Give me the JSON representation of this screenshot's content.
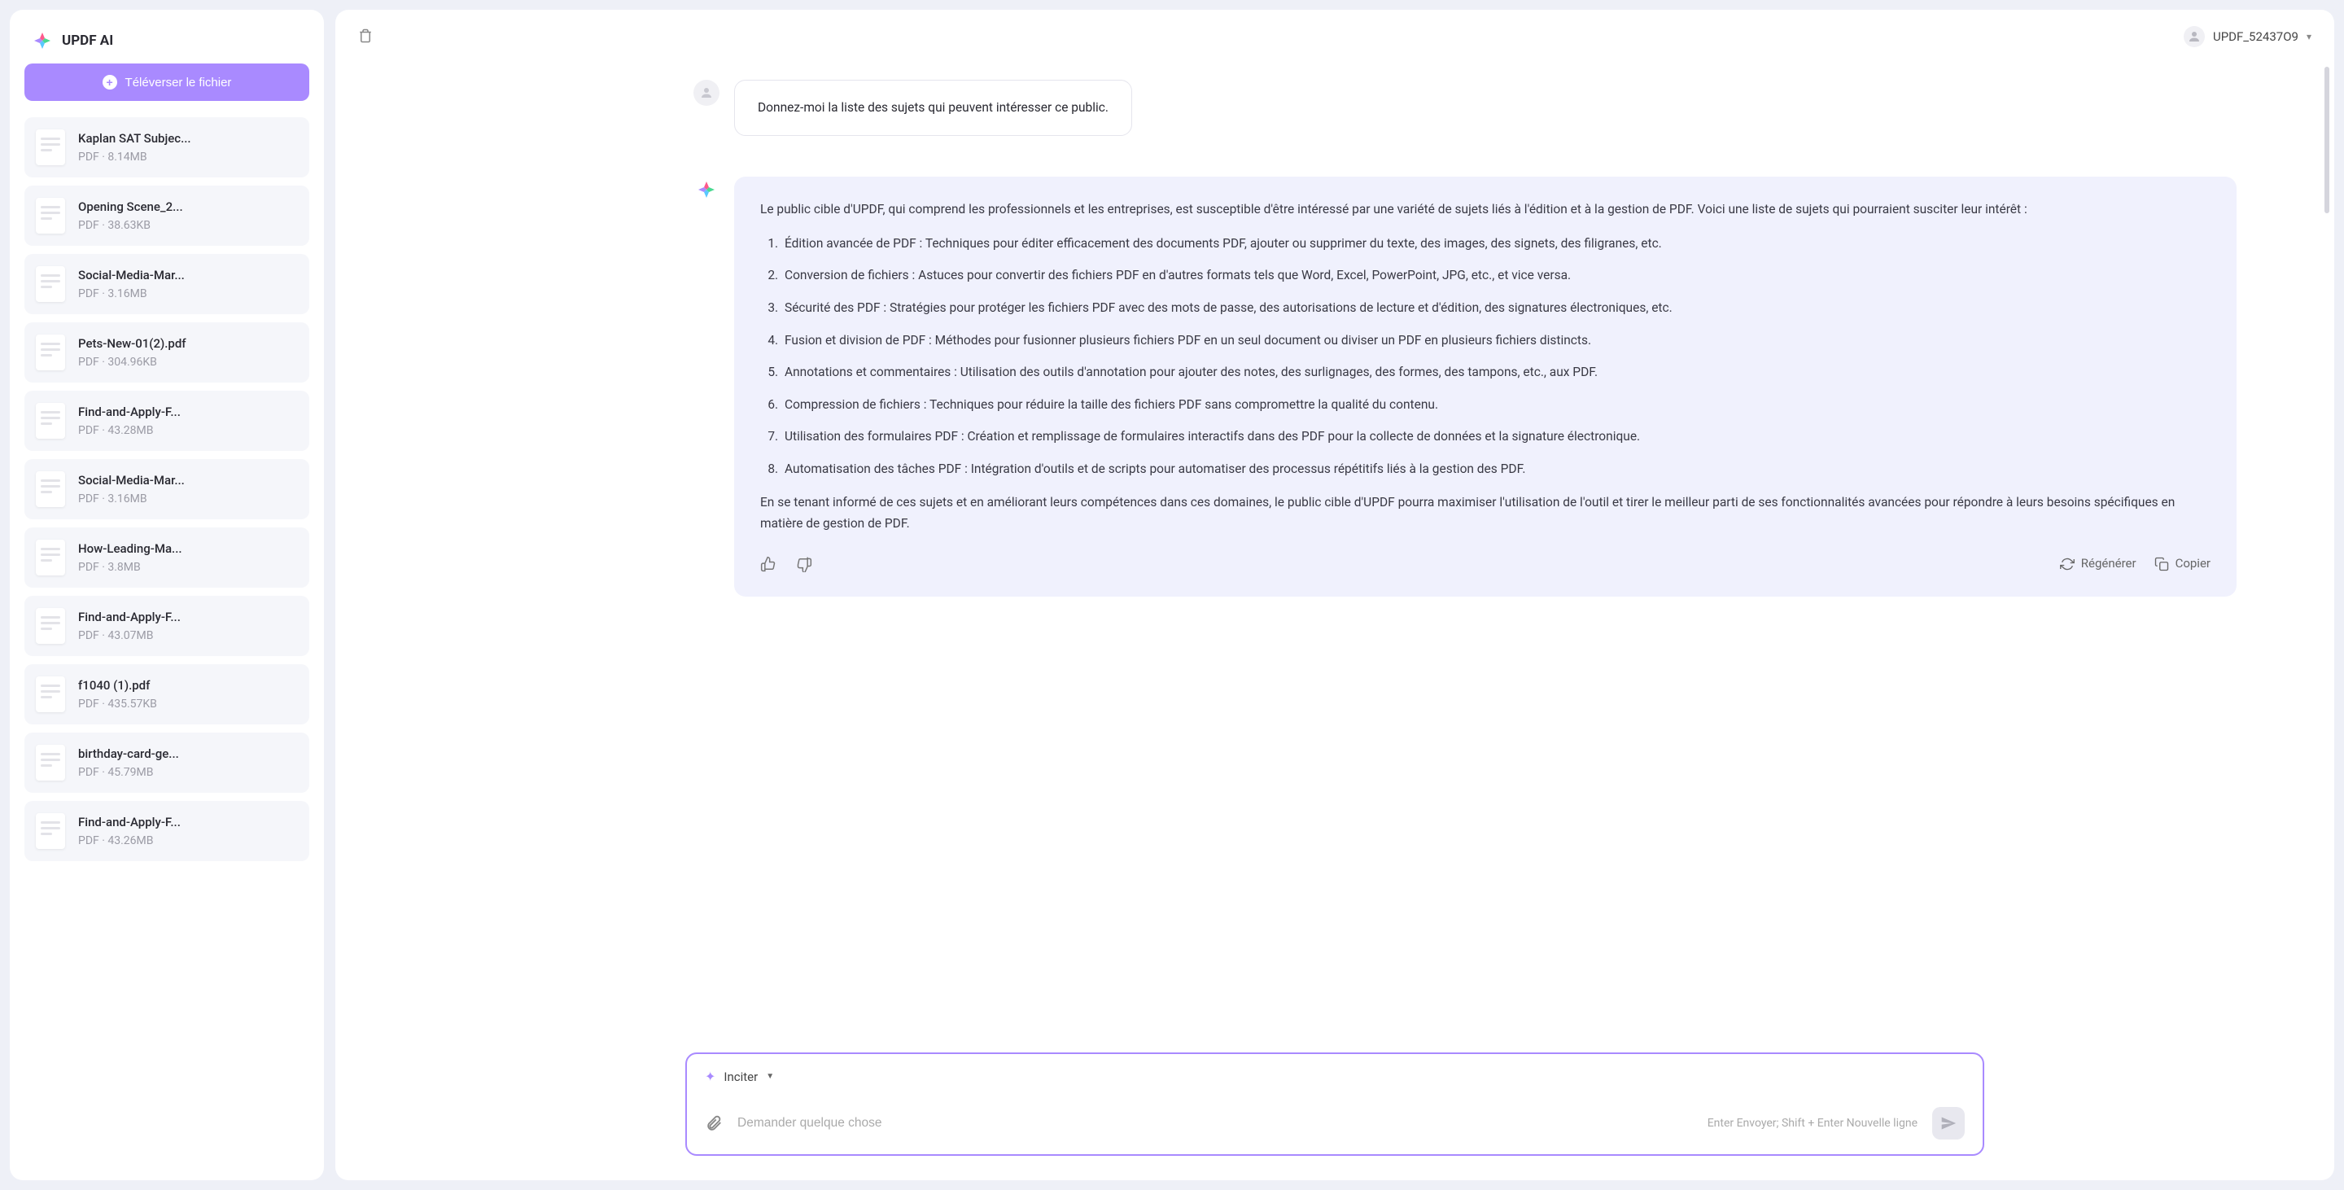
{
  "app": {
    "name": "UPDF AI"
  },
  "upload": {
    "label": "Téléverser le fichier"
  },
  "files": [
    {
      "name": "Kaplan SAT Subjec...",
      "meta": "PDF · 8.14MB"
    },
    {
      "name": "Opening Scene_2...",
      "meta": "PDF · 38.63KB"
    },
    {
      "name": "Social-Media-Mar...",
      "meta": "PDF · 3.16MB"
    },
    {
      "name": "Pets-New-01(2).pdf",
      "meta": "PDF · 304.96KB"
    },
    {
      "name": "Find-and-Apply-F...",
      "meta": "PDF · 43.28MB"
    },
    {
      "name": "Social-Media-Mar...",
      "meta": "PDF · 3.16MB"
    },
    {
      "name": "How-Leading-Ma...",
      "meta": "PDF · 3.8MB"
    },
    {
      "name": "Find-and-Apply-F...",
      "meta": "PDF · 43.07MB"
    },
    {
      "name": "f1040 (1).pdf",
      "meta": "PDF · 435.57KB"
    },
    {
      "name": "birthday-card-ge...",
      "meta": "PDF · 45.79MB"
    },
    {
      "name": "Find-and-Apply-F...",
      "meta": "PDF · 43.26MB"
    }
  ],
  "user": {
    "name": "UPDF_52437O9"
  },
  "chat": {
    "user_msg": "Donnez-moi la liste des sujets qui peuvent intéresser ce public.",
    "ai": {
      "intro": "Le public cible d'UPDF, qui comprend les professionnels et les entreprises, est susceptible d'être intéressé par une variété de sujets liés à l'édition et à la gestion de PDF. Voici une liste de sujets qui pourraient susciter leur intérêt :",
      "items": [
        "Édition avancée de PDF : Techniques pour éditer efficacement des documents PDF, ajouter ou supprimer du texte, des images, des signets, des filigranes, etc.",
        "Conversion de fichiers : Astuces pour convertir des fichiers PDF en d'autres formats tels que Word, Excel, PowerPoint, JPG, etc., et vice versa.",
        "Sécurité des PDF : Stratégies pour protéger les fichiers PDF avec des mots de passe, des autorisations de lecture et d'édition, des signatures électroniques, etc.",
        "Fusion et division de PDF : Méthodes pour fusionner plusieurs fichiers PDF en un seul document ou diviser un PDF en plusieurs fichiers distincts.",
        "Annotations et commentaires : Utilisation des outils d'annotation pour ajouter des notes, des surlignages, des formes, des tampons, etc., aux PDF.",
        "Compression de fichiers : Techniques pour réduire la taille des fichiers PDF sans compromettre la qualité du contenu.",
        "Utilisation des formulaires PDF : Création et remplissage de formulaires interactifs dans des PDF pour la collecte de données et la signature électronique.",
        "Automatisation des tâches PDF : Intégration d'outils et de scripts pour automatiser des processus répétitifs liés à la gestion des PDF."
      ],
      "outro": "En se tenant informé de ces sujets et en améliorant leurs compétences dans ces domaines, le public cible d'UPDF pourra maximiser l'utilisation de l'outil et tirer le meilleur parti de ses fonctionnalités avancées pour répondre à leurs besoins spécifiques en matière de gestion de PDF."
    },
    "actions": {
      "regenerate": "Régénérer",
      "copy": "Copier"
    }
  },
  "input": {
    "inciter": "Inciter",
    "placeholder": "Demander quelque chose",
    "hint": "Enter Envoyer; Shift + Enter Nouvelle ligne"
  }
}
